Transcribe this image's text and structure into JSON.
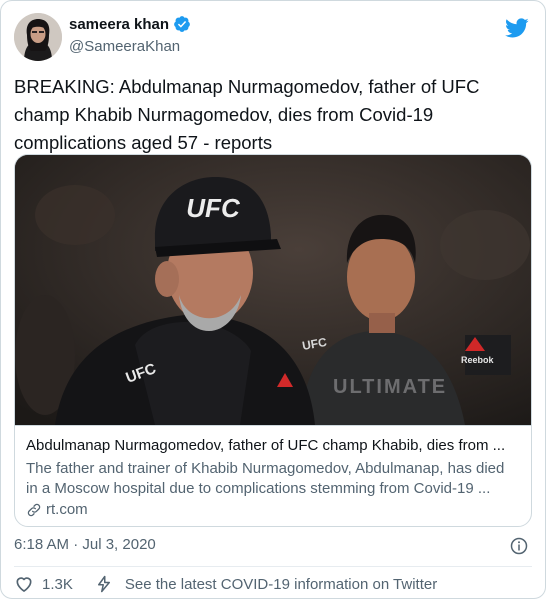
{
  "author": {
    "display_name": "sameera khan",
    "handle": "@SameeraKhan",
    "verified": true
  },
  "tweet": {
    "text": "BREAKING: Abdulmanap Nurmagomedov, father of UFC champ Khabib Nurmagomedov, dies from Covid-19 complications aged 57 - reports",
    "timestamp": "6:18 AM · Jul 3, 2020"
  },
  "card": {
    "title": "Abdulmanap Nurmagomedov, father of UFC champ Khabib, dies from ...",
    "description": "The father and trainer of Khabib Nurmagomedov, Abdulmanap, has died in a Moscow hospital due to complications stemming from Covid-19 ...",
    "domain": "rt.com",
    "image_text": {
      "cap": "UFC",
      "hoodie": "UFC",
      "shirt_left": "UFC",
      "shirt_right": "Reebok",
      "shirt_print": "ULTIMATE"
    }
  },
  "actions": {
    "like_count": "1.3K",
    "covid_link": "See the latest COVID-19 information on Twitter"
  },
  "colors": {
    "twitter_blue": "#1d9bf0",
    "text_primary": "#0f1419",
    "text_secondary": "#536471",
    "border": "#cfd9de"
  },
  "icons": [
    "verified-badge-icon",
    "twitter-bird-icon",
    "link-icon",
    "info-icon",
    "heart-icon",
    "lightning-icon"
  ]
}
